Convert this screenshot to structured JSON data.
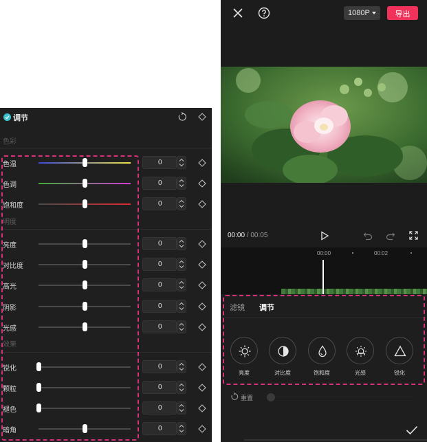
{
  "left_panel": {
    "title": "调节",
    "sections": {
      "color": "色彩",
      "light": "明度",
      "effect": "效果"
    },
    "rows": [
      {
        "label": "色温",
        "value": "0",
        "slider": 0.5
      },
      {
        "label": "色调",
        "value": "0",
        "slider": 0.5
      },
      {
        "label": "饱和度",
        "value": "0",
        "slider": 0.5
      },
      {
        "label": "亮度",
        "value": "0",
        "slider": 0.5
      },
      {
        "label": "对比度",
        "value": "0",
        "slider": 0.5
      },
      {
        "label": "高光",
        "value": "0",
        "slider": 0.5
      },
      {
        "label": "阴影",
        "value": "0",
        "slider": 0.5
      },
      {
        "label": "光感",
        "value": "0",
        "slider": 0.5
      },
      {
        "label": "锐化",
        "value": "0",
        "slider": 0.0
      },
      {
        "label": "颗粒",
        "value": "0",
        "slider": 0.0
      },
      {
        "label": "褪色",
        "value": "0",
        "slider": 0.0
      },
      {
        "label": "暗角",
        "value": "0",
        "slider": 0.5
      }
    ],
    "icons": {
      "check": "check-circle-icon",
      "reset": "reset-icon",
      "keyframe": "diamond-keyframe-icon",
      "stepper": "stepper-arrows-icon"
    },
    "colors": {
      "accent": "#3fc2cf",
      "highlight": "#d7317a"
    }
  },
  "phone": {
    "resolution": "1080P",
    "export_label": "导出",
    "time_current": "00:00",
    "time_separator": " / ",
    "time_total": "00:05",
    "timeline_ticks": [
      "00:00",
      "00:02"
    ],
    "tabs": {
      "filter": "滤镜",
      "adjust": "调节"
    },
    "tools": [
      {
        "label": "亮度",
        "icon": "sun-icon"
      },
      {
        "label": "对比度",
        "icon": "contrast-icon"
      },
      {
        "label": "饱和度",
        "icon": "drop-icon"
      },
      {
        "label": "光感",
        "icon": "light-sense-icon"
      },
      {
        "label": "锐化",
        "icon": "triangle-icon"
      }
    ],
    "reset_label": "重置",
    "colors": {
      "export": "#f0325a",
      "background": "#1c1c1c"
    }
  }
}
